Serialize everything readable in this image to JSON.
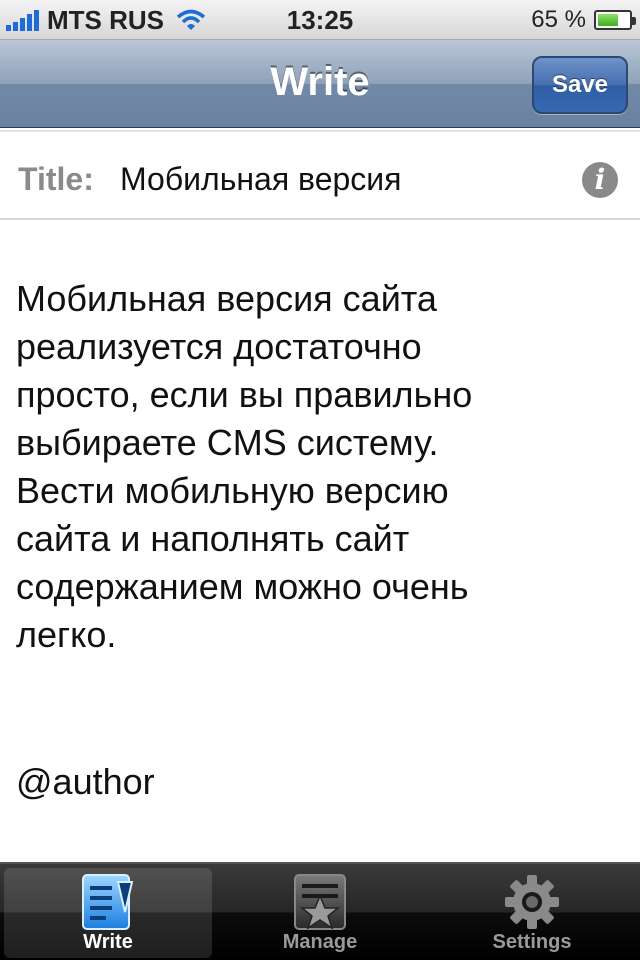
{
  "status_bar": {
    "carrier": "MTS RUS",
    "time": "13:25",
    "battery_percent": "65 %",
    "battery_level": 0.65
  },
  "nav_bar": {
    "title": "Write",
    "save_label": "Save"
  },
  "post": {
    "title_label": "Title:",
    "title_value": "Мобильная версия",
    "body_lines": [
      "Мобильная версия сайта",
      "реализуется достаточно",
      "просто, если вы правильно",
      "выбираете CMS систему.",
      "Вести мобильную версию",
      "сайта и наполнять сайт",
      "содержанием можно очень",
      "легко."
    ],
    "author": "@author"
  },
  "tab_bar": {
    "tabs": [
      {
        "label": "Write",
        "icon": "write-icon",
        "active": true
      },
      {
        "label": "Manage",
        "icon": "manage-icon",
        "active": false
      },
      {
        "label": "Settings",
        "icon": "settings-icon",
        "active": false
      }
    ]
  },
  "colors": {
    "nav_bar": "#7289a6",
    "save_button": "#3668b2",
    "active_tab_icon": "#3aa0ff"
  }
}
